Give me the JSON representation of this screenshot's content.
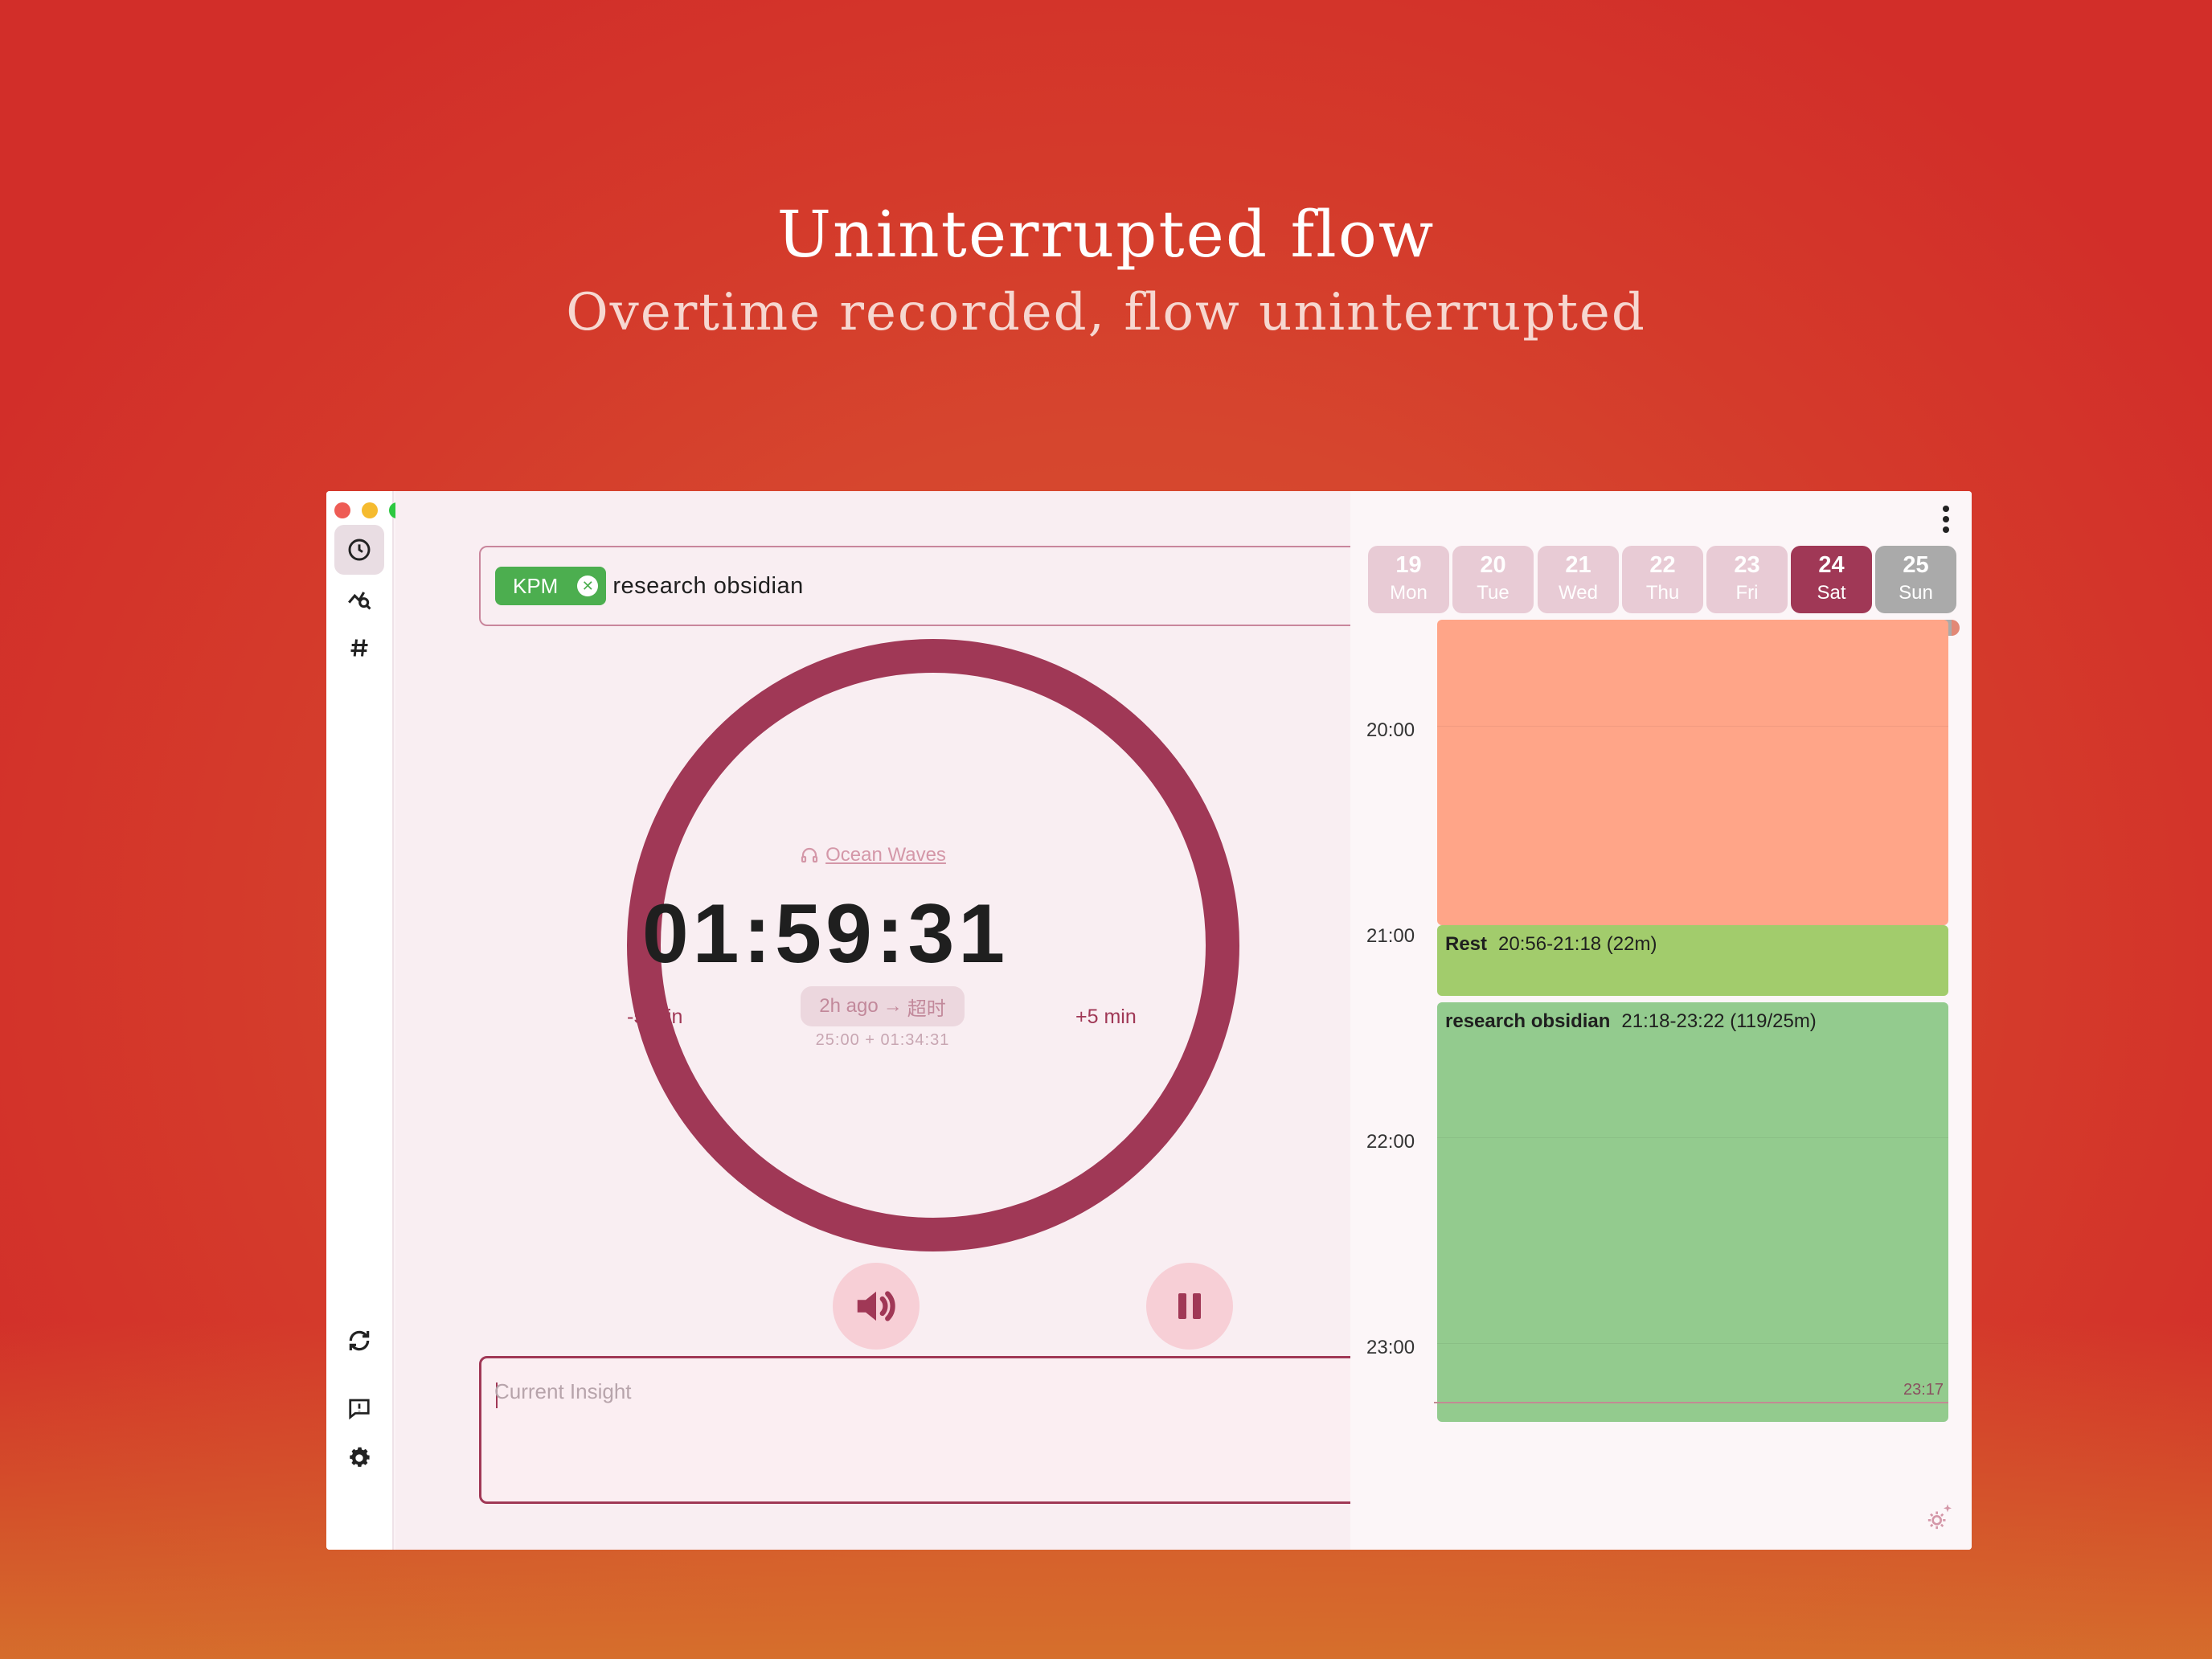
{
  "promo": {
    "title": "Uninterrupted flow",
    "subtitle": "Overtime recorded, flow uninterrupted"
  },
  "window": {
    "traffic_lights": [
      "#ee5c55",
      "#f5bb2f",
      "#2dc840"
    ],
    "menu_icon": "more-vertical-icon"
  },
  "sidebar": {
    "top_items": [
      {
        "name": "timer",
        "icon": "clock-icon",
        "active": true
      },
      {
        "name": "stats",
        "icon": "chart-search-icon",
        "active": false
      },
      {
        "name": "tags",
        "icon": "hashtag-icon",
        "active": false
      }
    ],
    "bottom_items": [
      {
        "name": "sync",
        "icon": "sync-icon"
      },
      {
        "name": "feedback",
        "icon": "feedback-icon"
      },
      {
        "name": "settings",
        "icon": "gear-icon"
      }
    ]
  },
  "task": {
    "tag_label": "KPM",
    "tag_color": "#4cae4f",
    "name": "research obsidian"
  },
  "timer": {
    "sound_label": "Ocean Waves",
    "display": "01:59:31",
    "minus_label": "-5 min",
    "plus_label": "+5 min",
    "ago_label": "2h ago",
    "overtime_label": "超时",
    "overtime_detail": "25:00 + 01:34:31",
    "ring_color": "#a03856"
  },
  "controls": {
    "sound_icon": "speaker-icon",
    "pause_icon": "pause-icon",
    "skip_icon": "skip-next-icon"
  },
  "insight": {
    "placeholder": "Current Insight",
    "value": ""
  },
  "calendar": {
    "days": [
      {
        "num": "19",
        "weekday": "Mon",
        "state": "past"
      },
      {
        "num": "20",
        "weekday": "Tue",
        "state": "past"
      },
      {
        "num": "21",
        "weekday": "Wed",
        "state": "past"
      },
      {
        "num": "22",
        "weekday": "Thu",
        "state": "past"
      },
      {
        "num": "23",
        "weekday": "Fri",
        "state": "past"
      },
      {
        "num": "24",
        "weekday": "Sat",
        "state": "today"
      },
      {
        "num": "25",
        "weekday": "Sun",
        "state": "future"
      }
    ],
    "hours": [
      "20:00",
      "21:00",
      "22:00",
      "23:00"
    ],
    "events": [
      {
        "kind": "focus",
        "title": "",
        "range": "",
        "color": "#ffa588"
      },
      {
        "kind": "rest",
        "title": "Rest",
        "range": "20:56-21:18 (22m)",
        "color": "#a2cc6c"
      },
      {
        "kind": "focus",
        "title": "research obsidian",
        "range": "21:18-23:22 (119/25m)",
        "color": "#93cb8e"
      }
    ],
    "now_label": "23:17",
    "now_line_color": "#c28b93"
  }
}
